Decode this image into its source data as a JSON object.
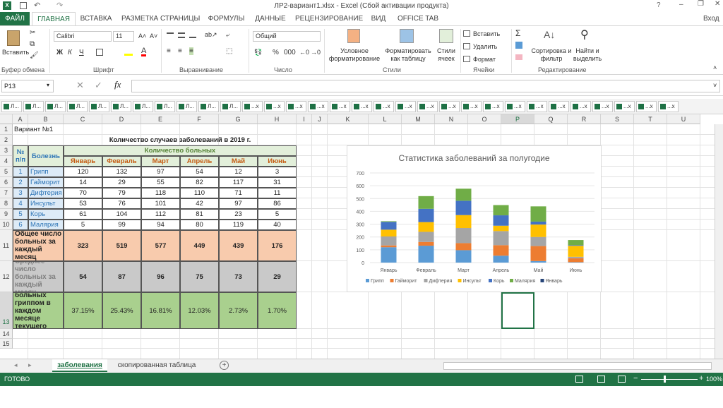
{
  "titlebar": {
    "title": "ЛР2-вариант1.xlsx - Excel (Сбой активации продукта)",
    "help": "?",
    "signin": "Вход"
  },
  "ribbon": {
    "file_tab": "ФАЙЛ",
    "tabs": [
      "ГЛАВНАЯ",
      "ВСТАВКА",
      "РАЗМЕТКА СТРАНИЦЫ",
      "ФОРМУЛЫ",
      "ДАННЫЕ",
      "РЕЦЕНЗИРОВАНИЕ",
      "ВИД",
      "OFFICE TAB"
    ],
    "groups": [
      "Буфер обмена",
      "Шрифт",
      "Выравнивание",
      "Число",
      "Стили",
      "Ячейки",
      "Редактирование"
    ],
    "paste": "Вставить",
    "font_name": "Calibri",
    "font_size": "11",
    "bold": "Ж",
    "italic": "К",
    "underline": "Ч",
    "number_format": "Общий",
    "cond_format": "Условное форматирование",
    "format_table": "Форматировать как таблицу",
    "cell_styles": "Стили ячеек",
    "insert": "Вставить",
    "delete": "Удалить",
    "format": "Формат",
    "sort": "Сортировка и фильтр",
    "find": "Найти и выделить"
  },
  "formula_bar": {
    "name_box": "P13",
    "fx": "fx",
    "value": ""
  },
  "workbook_tabs": [
    "Л...",
    "Л...",
    "Л...",
    "Л...",
    "Л...",
    "Л...",
    "Л...",
    "Л...",
    "Л...",
    "Л...",
    "Л...",
    "...x",
    "...x",
    "...x",
    "...x",
    "...x",
    "...x",
    "...x",
    "...x",
    "...x",
    "...x",
    "...x",
    "...x",
    "...x",
    "...x",
    "...x",
    "...x",
    "...x",
    "...x",
    "...x",
    "...x"
  ],
  "columns": [
    "A",
    "B",
    "C",
    "D",
    "E",
    "F",
    "G",
    "H",
    "I",
    "J",
    "K",
    "L",
    "M",
    "N",
    "O",
    "P",
    "Q",
    "R",
    "S",
    "T",
    "U"
  ],
  "rows": [
    "1",
    "2",
    "3",
    "4",
    "5",
    "6",
    "7",
    "8",
    "9",
    "10",
    "11",
    "12",
    "13",
    "14",
    "15"
  ],
  "sheet": {
    "a1": "Вариант №1",
    "title": "Количество случаев заболеваний в 2019 г.",
    "hdr_num": "№ п/п",
    "hdr_disease": "Болезнь",
    "hdr_count": "Количество больных",
    "months": [
      "Январь",
      "Февраль",
      "Март",
      "Апрель",
      "Май",
      "Июнь"
    ],
    "diseases": [
      {
        "n": "1",
        "name": "Грипп",
        "v": [
          "120",
          "132",
          "97",
          "54",
          "12",
          "3"
        ]
      },
      {
        "n": "2",
        "name": "Гайморит",
        "v": [
          "14",
          "29",
          "55",
          "82",
          "117",
          "31"
        ]
      },
      {
        "n": "3",
        "name": "Дифтерия",
        "v": [
          "70",
          "79",
          "118",
          "110",
          "71",
          "11"
        ]
      },
      {
        "n": "4",
        "name": "Инсульт",
        "v": [
          "53",
          "76",
          "101",
          "42",
          "97",
          "86"
        ]
      },
      {
        "n": "5",
        "name": "Корь",
        "v": [
          "61",
          "104",
          "112",
          "81",
          "23",
          "5"
        ]
      },
      {
        "n": "6",
        "name": "Малярия",
        "v": [
          "5",
          "99",
          "94",
          "80",
          "119",
          "40"
        ]
      }
    ],
    "total_label": "Общее число больных за каждый месяц",
    "total": [
      "323",
      "519",
      "577",
      "449",
      "439",
      "176"
    ],
    "avg_label": "Среднее число больных за каждый месяц",
    "avg": [
      "54",
      "87",
      "96",
      "75",
      "73",
      "29"
    ],
    "pct_label": "Процент больных гриппом в каждом месяце текущего года",
    "pct": [
      "37.15%",
      "25.43%",
      "16.81%",
      "12.03%",
      "2.73%",
      "1.70%"
    ]
  },
  "chart_data": {
    "type": "bar",
    "stacked": true,
    "title": "Статистика заболеваний за полугодие",
    "categories": [
      "Январь",
      "Февраль",
      "Март",
      "Апрель",
      "Май",
      "Июнь"
    ],
    "ylim": [
      0,
      700
    ],
    "yticks": [
      "0",
      "100",
      "200",
      "300",
      "400",
      "500",
      "600",
      "700"
    ],
    "series": [
      {
        "name": "Грипп",
        "color": "#5b9bd5",
        "values": [
          120,
          132,
          97,
          54,
          12,
          3
        ]
      },
      {
        "name": "Гайморит",
        "color": "#ed7d31",
        "values": [
          14,
          29,
          55,
          82,
          117,
          31
        ]
      },
      {
        "name": "Дифтерия",
        "color": "#a5a5a5",
        "values": [
          70,
          79,
          118,
          110,
          71,
          11
        ]
      },
      {
        "name": "Инсульт",
        "color": "#ffc000",
        "values": [
          53,
          76,
          101,
          42,
          97,
          86
        ]
      },
      {
        "name": "Корь",
        "color": "#4472c4",
        "values": [
          61,
          104,
          112,
          81,
          23,
          5
        ]
      },
      {
        "name": "Малярия",
        "color": "#70ad47",
        "values": [
          5,
          99,
          94,
          80,
          119,
          40
        ]
      },
      {
        "name": "Январь",
        "color": "#264478",
        "values": [
          0,
          0,
          0,
          0,
          0,
          0
        ]
      }
    ],
    "legend": "bottom",
    "grid": true
  },
  "sheets": {
    "active": "заболевания",
    "other": "скопированная таблица"
  },
  "status": {
    "ready": "ГОТОВО",
    "zoom": "100%"
  },
  "colors": {
    "excel_green": "#217346",
    "header_fill": "#e2efda",
    "disease_fill": "#ddebf7",
    "total_fill": "#f8cbad",
    "avg_fill": "#c9c9c9",
    "pct_fill": "#a9d08e"
  }
}
